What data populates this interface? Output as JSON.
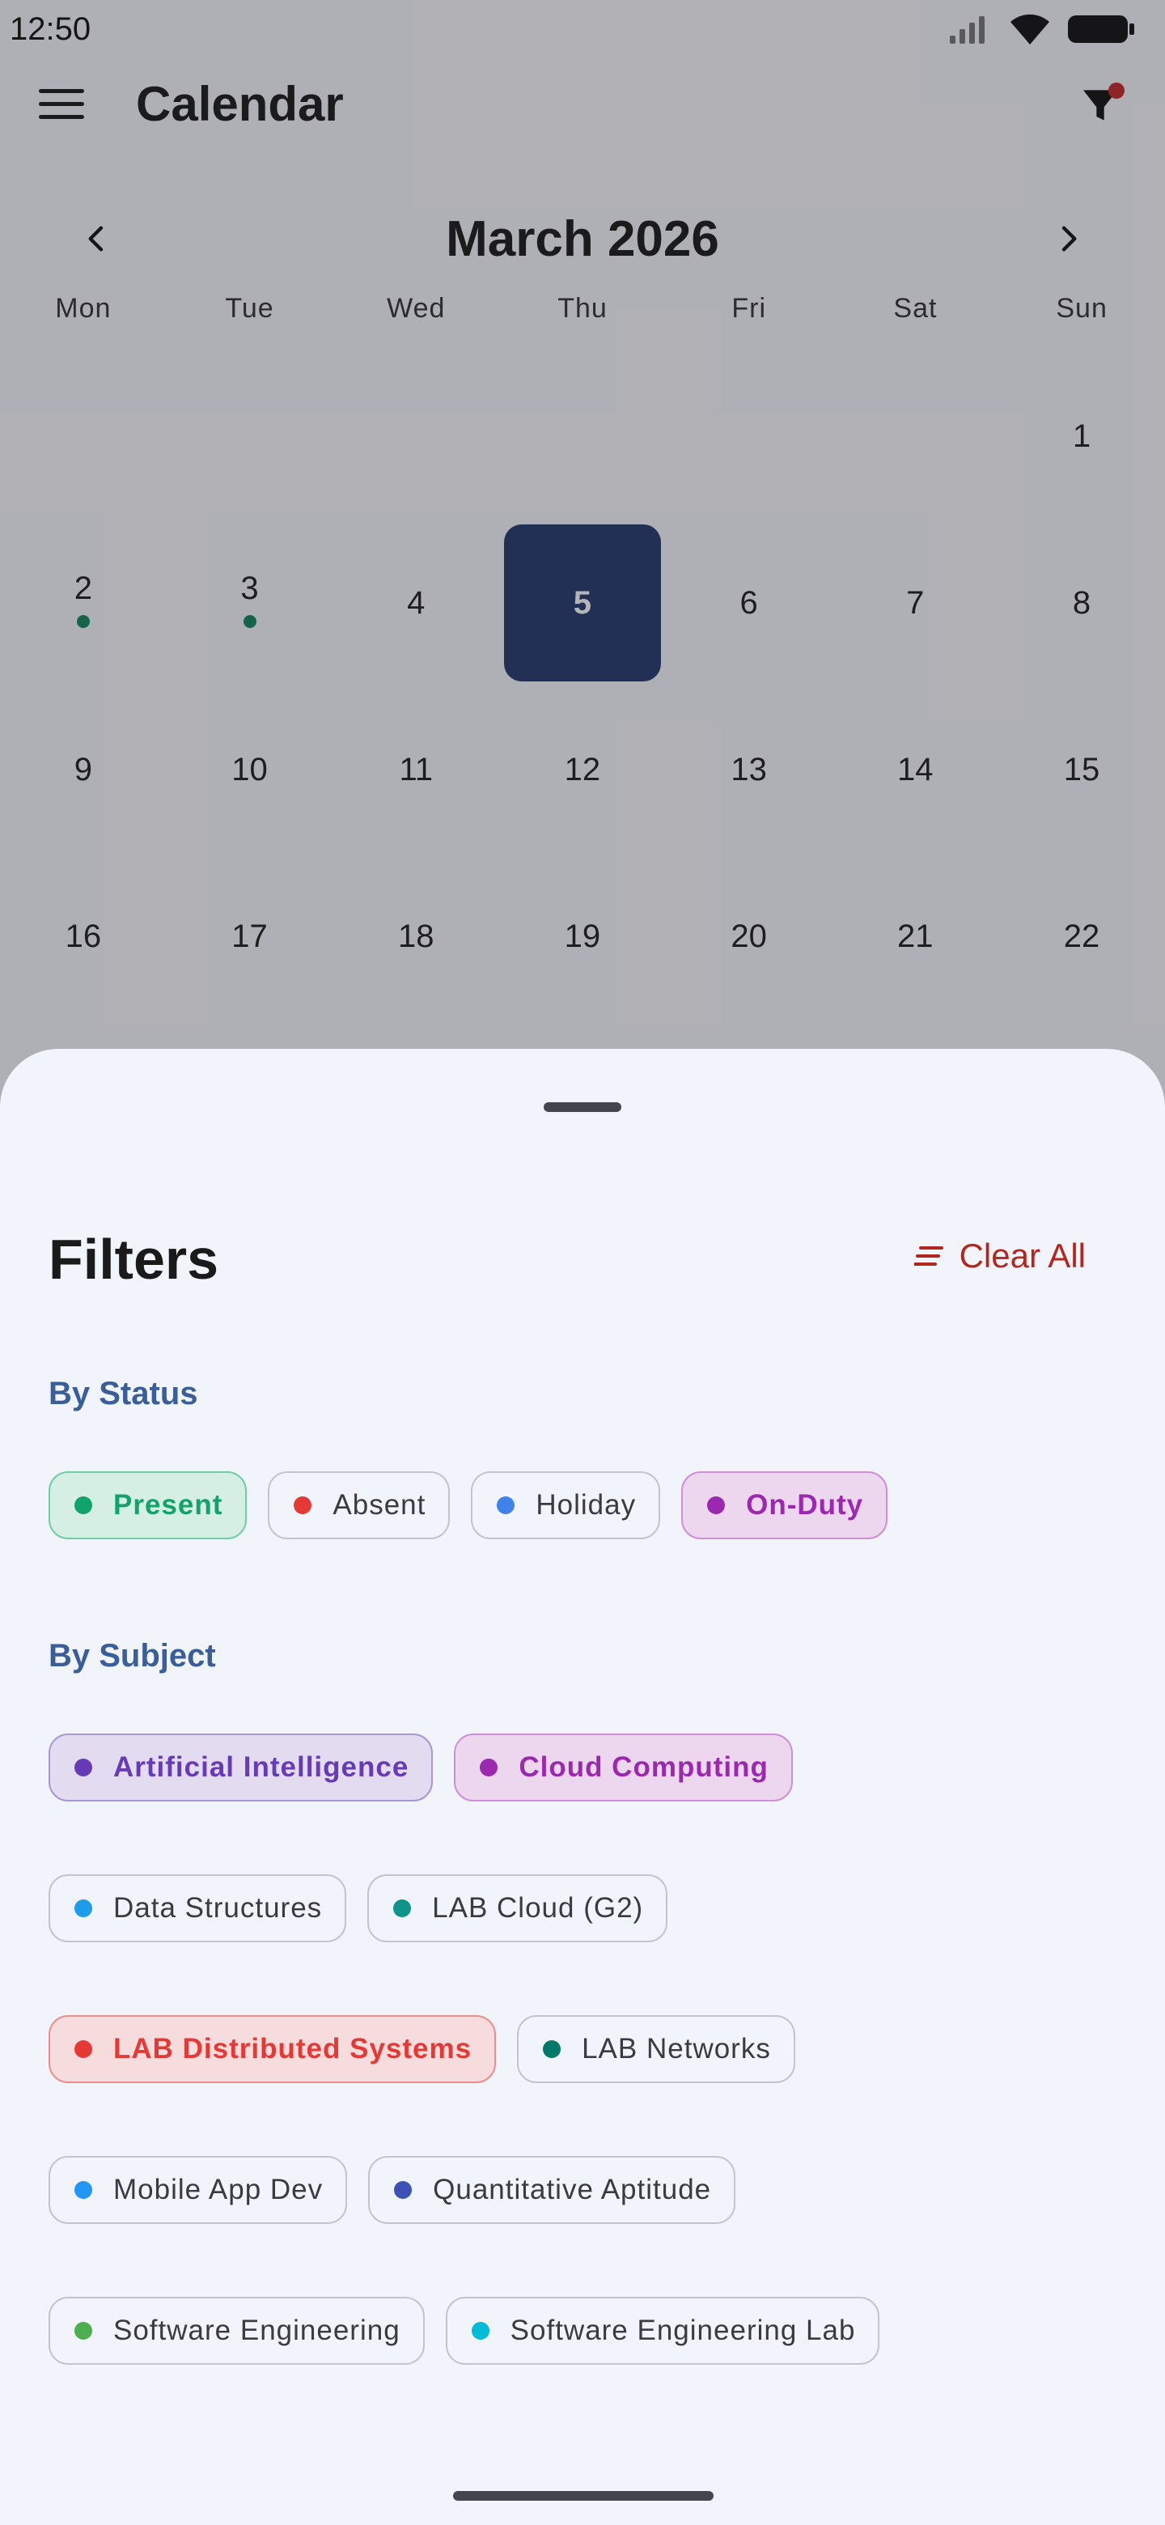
{
  "status_bar": {
    "time": "12:50"
  },
  "app_bar": {
    "title": "Calendar"
  },
  "calendar": {
    "month_title": "March 2026",
    "weekdays": [
      "Mon",
      "Tue",
      "Wed",
      "Thu",
      "Fri",
      "Sat",
      "Sun"
    ],
    "days": [
      "",
      "",
      "",
      "",
      "",
      "",
      "1",
      "2",
      "3",
      "4",
      "5",
      "6",
      "7",
      "8",
      "9",
      "10",
      "11",
      "12",
      "13",
      "14",
      "15",
      "16",
      "17",
      "18",
      "19",
      "20",
      "21",
      "22"
    ],
    "selected_day": "5",
    "days_with_dots": [
      "2",
      "3"
    ]
  },
  "sheet": {
    "title": "Filters",
    "clear_all": "Clear All",
    "status_label": "By Status",
    "subject_label": "By Subject",
    "status_chips": [
      {
        "label": "Present",
        "color": "#12a36a",
        "selected": true,
        "bg": "#d6efe4",
        "border": "#6fcea3",
        "text": "#12a36a"
      },
      {
        "label": "Absent",
        "color": "#e53935",
        "selected": false
      },
      {
        "label": "Holiday",
        "color": "#3f82ec",
        "selected": false
      },
      {
        "label": "On-Duty",
        "color": "#9c27b0",
        "selected": true,
        "bg": "#ecd7ef",
        "border": "#cf8fd8",
        "text": "#9c27b0"
      }
    ],
    "subject_rows": [
      [
        {
          "label": "Artificial Intelligence",
          "color": "#673ab7",
          "selected": true,
          "bg": "#e3dcf1",
          "border": "#a996d4",
          "text": "#673ab7"
        },
        {
          "label": "Cloud Computing",
          "color": "#9c27b0",
          "selected": true,
          "bg": "#ecd7ef",
          "border": "#cf8fd8",
          "text": "#9c27b0"
        }
      ],
      [
        {
          "label": "Data Structures",
          "color": "#1e9be9",
          "selected": false
        },
        {
          "label": "LAB Cloud (G2)",
          "color": "#0e9488",
          "selected": false
        }
      ],
      [
        {
          "label": "LAB Distributed Systems",
          "color": "#e53935",
          "selected": true,
          "bg": "#f6dcdc",
          "border": "#ec8f8c",
          "text": "#e53935"
        },
        {
          "label": "LAB Networks",
          "color": "#00796b",
          "selected": false
        }
      ],
      [
        {
          "label": "Mobile App Dev",
          "color": "#2196f3",
          "selected": false
        },
        {
          "label": "Quantitative Aptitude",
          "color": "#3f51b5",
          "selected": false
        }
      ],
      [
        {
          "label": "Software Engineering",
          "color": "#4caf50",
          "selected": false
        },
        {
          "label": "Software Engineering Lab",
          "color": "#00bcd4",
          "selected": false
        }
      ]
    ]
  }
}
